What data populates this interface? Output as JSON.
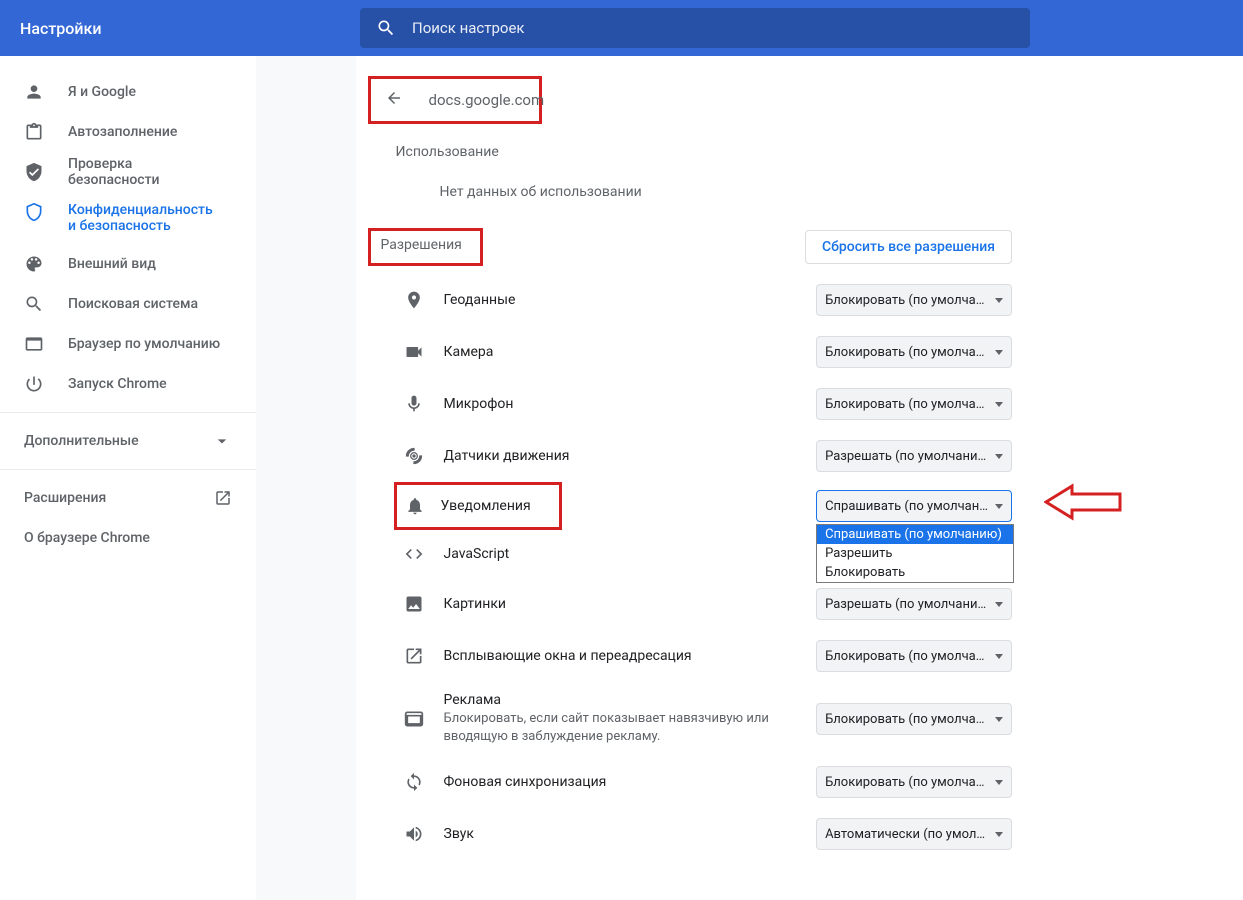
{
  "header": {
    "title": "Настройки",
    "search_placeholder": "Поиск настроек"
  },
  "sidebar": {
    "items": [
      {
        "id": "you-google",
        "label": "Я и Google"
      },
      {
        "id": "autofill",
        "label": "Автозаполнение"
      },
      {
        "id": "safety",
        "label": "Проверка безопасности"
      },
      {
        "id": "privacy",
        "label": "Конфиденциальность и безопасность",
        "active": true
      },
      {
        "id": "appearance",
        "label": "Внешний вид"
      },
      {
        "id": "search-engine",
        "label": "Поисковая система"
      },
      {
        "id": "default-browser",
        "label": "Браузер по умолчанию"
      },
      {
        "id": "on-startup",
        "label": "Запуск Chrome"
      }
    ],
    "advanced_label": "Дополнительные",
    "extensions_label": "Расширения",
    "about_label": "О браузере Chrome"
  },
  "site": {
    "domain": "docs.google.com"
  },
  "usage": {
    "section_label": "Использование",
    "none_label": "Нет данных об использовании"
  },
  "permissions": {
    "title": "Разрешения",
    "reset_label": "Сбросить все разрешения",
    "rows": [
      {
        "id": "location",
        "label": "Геоданные",
        "value": "Блокировать (по умолчанию)"
      },
      {
        "id": "camera",
        "label": "Камера",
        "value": "Блокировать (по умолчанию)"
      },
      {
        "id": "microphone",
        "label": "Микрофон",
        "value": "Блокировать (по умолчанию)"
      },
      {
        "id": "motion",
        "label": "Датчики движения",
        "value": "Разрешать (по умолчанию)"
      },
      {
        "id": "notifications",
        "label": "Уведомления",
        "value": "Спрашивать (по умолчанию)",
        "open": true,
        "options": [
          "Спрашивать (по умолчанию)",
          "Разрешить",
          "Блокировать"
        ]
      },
      {
        "id": "javascript",
        "label": "JavaScript",
        "value": ""
      },
      {
        "id": "images",
        "label": "Картинки",
        "value": "Разрешать (по умолчанию)"
      },
      {
        "id": "popups",
        "label": "Всплывающие окна и переадресация",
        "value": "Блокировать (по умолчанию)"
      },
      {
        "id": "ads",
        "label": "Реклама",
        "sub": "Блокировать, если сайт показывает навязчивую или вводящую в заблуждение рекламу.",
        "value": "Блокировать (по умолчанию)"
      },
      {
        "id": "bg-sync",
        "label": "Фоновая синхронизация",
        "value": "Блокировать (по умолчанию)"
      },
      {
        "id": "sound",
        "label": "Звук",
        "value": "Автоматически (по умолчанию)"
      }
    ]
  }
}
